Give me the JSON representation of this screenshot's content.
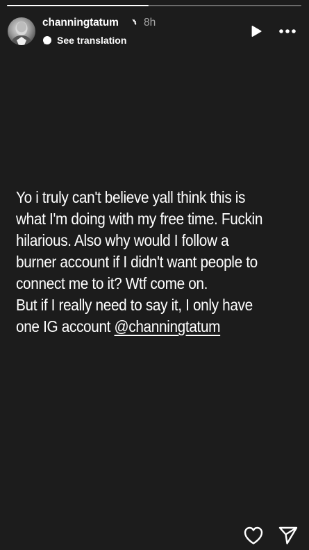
{
  "story": {
    "progress": 0.48,
    "background_color": "#1c1c1c"
  },
  "header": {
    "username": "channingtatum",
    "verified_icon": "verified-badge-icon",
    "time": "8h",
    "translation_label": "See translation",
    "translation_icon": "translate-icon",
    "play_icon": "play-icon",
    "more_icon": "more-options-icon"
  },
  "caption": {
    "lines": [
      "Yo i truly can't believe yall think this is",
      "what I'm doing with my free time. Fuckin",
      "hilarious. Also why would I follow a",
      "burner account if I didn't want people to",
      "connect me to it? Wtf come on.",
      "But if I really need to say it, I only have",
      "one IG account "
    ],
    "mention": "@channingtatum"
  },
  "footer": {
    "like_icon": "heart-icon",
    "share_icon": "send-icon"
  }
}
